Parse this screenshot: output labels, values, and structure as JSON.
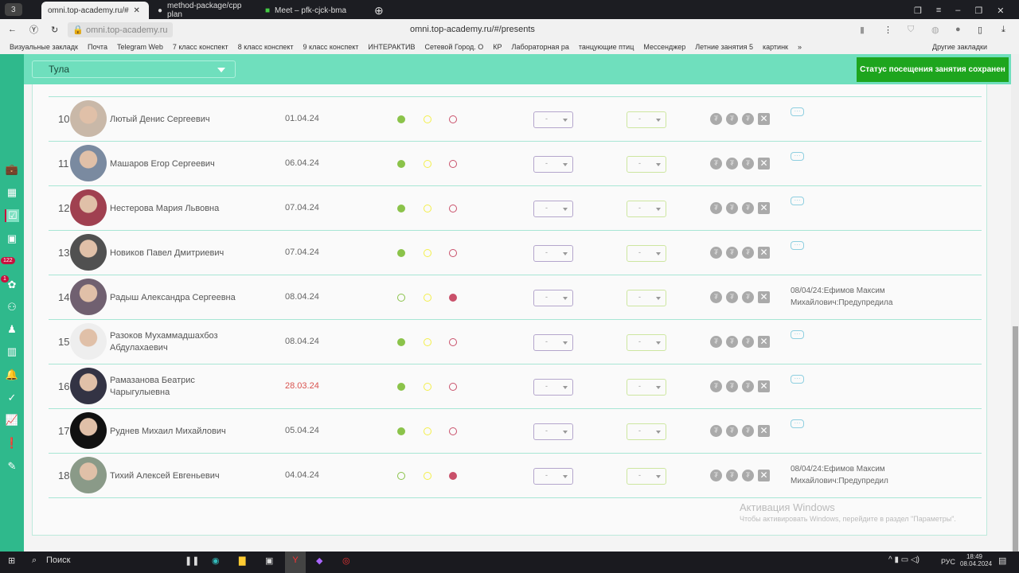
{
  "browser": {
    "tab_count": "3",
    "tabs": [
      "omni.top-academy.ru/#",
      "method-package/cpp plan",
      "Meet – pfk-cjck-bma"
    ],
    "url_domain": "omni.top-academy.ru",
    "page_title": "omni.top-academy.ru/#/presents",
    "bookmarks": [
      "Визуальные закладк",
      "Почта",
      "Telegram Web",
      "7 класс конспект",
      "8 класс конспект",
      "9 класс конспект",
      "ИНТЕРАКТИВ",
      "Сетевой Город. О",
      "КР",
      "Лабораторная ра",
      "танцующие птиц",
      "Мессенджер",
      "Летние занятия 5",
      "картинк",
      "»",
      "Другие закладки"
    ]
  },
  "sidebar": {
    "badges": [
      "122",
      "1"
    ]
  },
  "header": {
    "city": "Тула",
    "toast": "Статус посещения занятия сохранен"
  },
  "colors": {
    "present": "#8bc34a",
    "late": "#f3ef4a",
    "absent": "#c9506a",
    "sidebar": "#2fb98c",
    "header": "#6fdfbd",
    "toast": "#1ea51e"
  },
  "students": [
    {
      "n": "10",
      "name": "Лютый Денис Сергеевич",
      "date": "01.04.24",
      "status": "present",
      "grade1": "-",
      "grade2": "-",
      "comment": ""
    },
    {
      "n": "11",
      "name": "Машаров Егор Сергеевич",
      "date": "06.04.24",
      "status": "present",
      "grade1": "-",
      "grade2": "-",
      "comment": ""
    },
    {
      "n": "12",
      "name": "Нестерова Мария Львовна",
      "date": "07.04.24",
      "status": "present",
      "grade1": "-",
      "grade2": "-",
      "comment": ""
    },
    {
      "n": "13",
      "name": "Новиков Павел Дмитриевич",
      "date": "07.04.24",
      "status": "present",
      "grade1": "-",
      "grade2": "-",
      "comment": ""
    },
    {
      "n": "14",
      "name": "Радыш Александра Сергеевна",
      "date": "08.04.24",
      "status": "absent",
      "grade1": "-",
      "grade2": "-",
      "comment": "08/04/24:Ефимов Максим Михайлович:Предупредила"
    },
    {
      "n": "15",
      "name": "Разоков Мухаммадшахбоз Абдулахаевич",
      "date": "08.04.24",
      "status": "present",
      "grade1": "-",
      "grade2": "-",
      "comment": ""
    },
    {
      "n": "16",
      "name": "Рамазанова Беатрис Чарыгулыевна",
      "date": "28.03.24",
      "status": "present",
      "late_date": true,
      "grade1": "-",
      "grade2": "-",
      "comment": ""
    },
    {
      "n": "17",
      "name": "Руднев Михаил Михайлович",
      "date": "05.04.24",
      "status": "present",
      "grade1": "-",
      "grade2": "-",
      "comment": ""
    },
    {
      "n": "18",
      "name": "Тихий Алексей Евгеньевич",
      "date": "04.04.24",
      "status": "absent",
      "grade1": "-",
      "grade2": "-",
      "comment": "08/04/24:Ефимов Максим Михайлович:Предупредил"
    }
  ],
  "watermark": {
    "title": "Активация Windows",
    "subtitle": "Чтобы активировать Windows, перейдите в раздел \"Параметры\"."
  },
  "taskbar": {
    "search": "Поиск",
    "lang": "РУС",
    "time": "18:49",
    "date": "08.04.2024"
  }
}
